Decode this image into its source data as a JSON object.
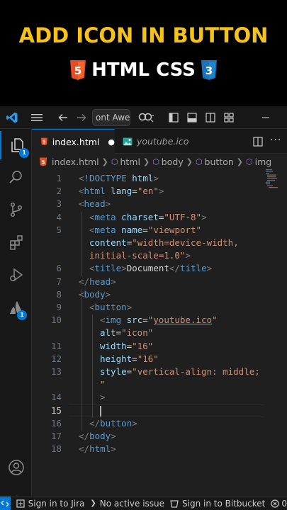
{
  "banner": {
    "title": "ADD ICON IN BUTTON",
    "subtitle": "HTML CSS",
    "html_badge": "5",
    "css_badge": "3",
    "title_color": "#f5c21b"
  },
  "titlebar": {
    "search_text": "ont Awes",
    "icons": [
      "vscode-logo-icon",
      "menu-icon",
      "back-arrow-icon",
      "forward-arrow-icon",
      "copilot-icon",
      "layout-icon",
      "panel-icon",
      "split-icon",
      "minimize-icon"
    ]
  },
  "activity": {
    "explorer_badge": "1",
    "extension_badge": "1"
  },
  "tabs": [
    {
      "label": "index.html",
      "modified": "●",
      "icon": "html5-file-icon"
    },
    {
      "label": "youtube.ico",
      "icon": "image-file-icon"
    }
  ],
  "breadcrumb": [
    "index.html",
    "html",
    "body",
    "button",
    "img"
  ],
  "editor": {
    "lines": [
      {
        "n": "1",
        "tokens": [
          [
            "c-br",
            "<"
          ],
          [
            "c-tag",
            "!DOCTYPE"
          ],
          [
            "c-txt",
            " "
          ],
          [
            "c-attr",
            "html"
          ],
          [
            "c-br",
            ">"
          ]
        ],
        "indent": 0
      },
      {
        "n": "2",
        "tokens": [
          [
            "c-br",
            "<"
          ],
          [
            "c-tag",
            "html"
          ],
          [
            "c-txt",
            " "
          ],
          [
            "c-attr",
            "lang"
          ],
          [
            "c-txt",
            "="
          ],
          [
            "c-str",
            "\"en\""
          ],
          [
            "c-br",
            ">"
          ]
        ],
        "indent": 0
      },
      {
        "n": "3",
        "tokens": [
          [
            "c-br",
            "<"
          ],
          [
            "c-tag",
            "head"
          ],
          [
            "c-br",
            ">"
          ]
        ],
        "indent": 0
      },
      {
        "n": "4",
        "tokens": [
          [
            "c-br",
            "<"
          ],
          [
            "c-tag",
            "meta"
          ],
          [
            "c-txt",
            " "
          ],
          [
            "c-attr",
            "charset"
          ],
          [
            "c-txt",
            "="
          ],
          [
            "c-str",
            "\"UTF-8\""
          ],
          [
            "c-br",
            ">"
          ]
        ],
        "indent": 1
      },
      {
        "n": "5",
        "tokens": [
          [
            "c-br",
            "<"
          ],
          [
            "c-tag",
            "meta"
          ],
          [
            "c-txt",
            " "
          ],
          [
            "c-attr",
            "name"
          ],
          [
            "c-txt",
            "="
          ],
          [
            "c-str",
            "\"viewport\""
          ]
        ],
        "indent": 1
      },
      {
        "n": "",
        "tokens": [
          [
            "c-attr",
            "content"
          ],
          [
            "c-txt",
            "="
          ],
          [
            "c-str",
            "\"width=device-width,"
          ]
        ],
        "indent": 1
      },
      {
        "n": "",
        "tokens": [
          [
            "c-str",
            "initial-scale=1.0\""
          ],
          [
            "c-br",
            ">"
          ]
        ],
        "indent": 1
      },
      {
        "n": "6",
        "tokens": [
          [
            "c-br",
            "<"
          ],
          [
            "c-tag",
            "title"
          ],
          [
            "c-br",
            ">"
          ],
          [
            "c-txt",
            "Document"
          ],
          [
            "c-br",
            "</"
          ],
          [
            "c-tag",
            "title"
          ],
          [
            "c-br",
            ">"
          ]
        ],
        "indent": 1
      },
      {
        "n": "7",
        "tokens": [
          [
            "c-br",
            "</"
          ],
          [
            "c-tag",
            "head"
          ],
          [
            "c-br",
            ">"
          ]
        ],
        "indent": 0
      },
      {
        "n": "8",
        "tokens": [
          [
            "c-br",
            "<"
          ],
          [
            "c-tag",
            "body"
          ],
          [
            "c-br",
            ">"
          ]
        ],
        "indent": 0
      },
      {
        "n": "9",
        "tokens": [
          [
            "c-br",
            "<"
          ],
          [
            "c-tag",
            "button"
          ],
          [
            "c-br",
            ">"
          ]
        ],
        "indent": 1
      },
      {
        "n": "10",
        "tokens": [
          [
            "c-br",
            "<"
          ],
          [
            "c-tag",
            "img"
          ],
          [
            "c-txt",
            " "
          ],
          [
            "c-attr",
            "src"
          ],
          [
            "c-txt",
            "="
          ],
          [
            "c-str",
            "\""
          ],
          [
            "c-link",
            "youtube.ico"
          ],
          [
            "c-str",
            "\""
          ]
        ],
        "indent": 2
      },
      {
        "n": "",
        "tokens": [
          [
            "c-attr",
            "alt"
          ],
          [
            "c-txt",
            "="
          ],
          [
            "c-str",
            "\"icon\""
          ]
        ],
        "indent": 2
      },
      {
        "n": "11",
        "tokens": [
          [
            "c-attr",
            "width"
          ],
          [
            "c-txt",
            "="
          ],
          [
            "c-str",
            "\"16\""
          ]
        ],
        "indent": 2
      },
      {
        "n": "12",
        "tokens": [
          [
            "c-attr",
            "height"
          ],
          [
            "c-txt",
            "="
          ],
          [
            "c-str",
            "\"16\""
          ]
        ],
        "indent": 2
      },
      {
        "n": "13",
        "tokens": [
          [
            "c-attr",
            "style"
          ],
          [
            "c-txt",
            "="
          ],
          [
            "c-str",
            "\"vertical-align: middle;"
          ]
        ],
        "indent": 2
      },
      {
        "n": "",
        "tokens": [
          [
            "c-str",
            "\""
          ]
        ],
        "indent": 2
      },
      {
        "n": "14",
        "tokens": [
          [
            "c-br",
            ">"
          ]
        ],
        "indent": 2
      },
      {
        "n": "15",
        "tokens": [
          [
            "c-txt",
            ""
          ]
        ],
        "indent": 2,
        "cursor": true
      },
      {
        "n": "16",
        "tokens": [
          [
            "c-br",
            "</"
          ],
          [
            "c-tag",
            "button"
          ],
          [
            "c-br",
            ">"
          ]
        ],
        "indent": 1
      },
      {
        "n": "17",
        "tokens": [
          [
            "c-br",
            "</"
          ],
          [
            "c-tag",
            "body"
          ],
          [
            "c-br",
            ">"
          ]
        ],
        "indent": 0
      },
      {
        "n": "18",
        "tokens": [
          [
            "c-br",
            "</"
          ],
          [
            "c-tag",
            "html"
          ],
          [
            "c-br",
            ">"
          ]
        ],
        "indent": 0
      }
    ]
  },
  "statusbar": {
    "jira": "Sign in to Jira",
    "issue": "No active issue",
    "bitbucket": "Sign in to Bitbucket",
    "errors": "0"
  },
  "colors": {
    "accent": "#0078d4",
    "editor_bg": "#1f1f1f",
    "chrome_bg": "#181818",
    "html5_orange": "#e44d26",
    "css3_blue": "#1b73ba"
  }
}
